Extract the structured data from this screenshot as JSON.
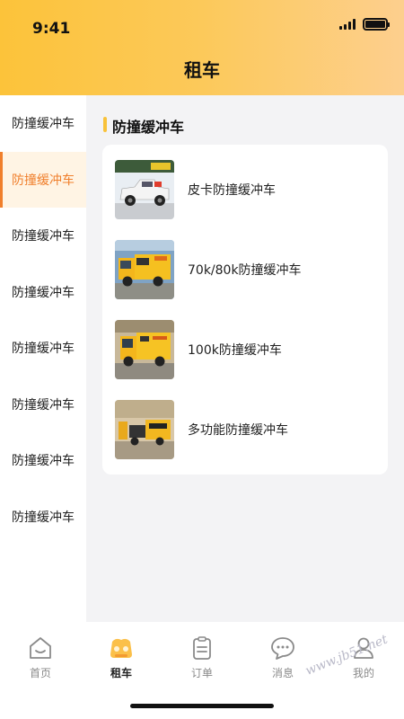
{
  "status": {
    "time": "9:41"
  },
  "header": {
    "title": "租车"
  },
  "sidebar": {
    "items": [
      {
        "label": "防撞缓冲车"
      },
      {
        "label": "防撞缓冲车"
      },
      {
        "label": "防撞缓冲车"
      },
      {
        "label": "防撞缓冲车"
      },
      {
        "label": "防撞缓冲车"
      },
      {
        "label": "防撞缓冲车"
      },
      {
        "label": "防撞缓冲车"
      },
      {
        "label": "防撞缓冲车"
      }
    ],
    "active_index": 1
  },
  "main": {
    "section_title": "防撞缓冲车",
    "items": [
      {
        "label": "皮卡防撞缓冲车"
      },
      {
        "label": "70k/80k防撞缓冲车"
      },
      {
        "label": "100k防撞缓冲车"
      },
      {
        "label": "多功能防撞缓冲车"
      }
    ]
  },
  "tabbar": {
    "tabs": [
      {
        "label": "首页",
        "icon": "home-icon"
      },
      {
        "label": "租车",
        "icon": "rent-car-icon"
      },
      {
        "label": "订单",
        "icon": "order-clipboard-icon"
      },
      {
        "label": "消息",
        "icon": "message-bubble-icon"
      },
      {
        "label": "我的",
        "icon": "profile-icon"
      }
    ],
    "active_index": 1
  },
  "watermark": "www.jb51.net",
  "colors": {
    "accent": "#f07f2c",
    "brand_yellow": "#fcc33a"
  }
}
